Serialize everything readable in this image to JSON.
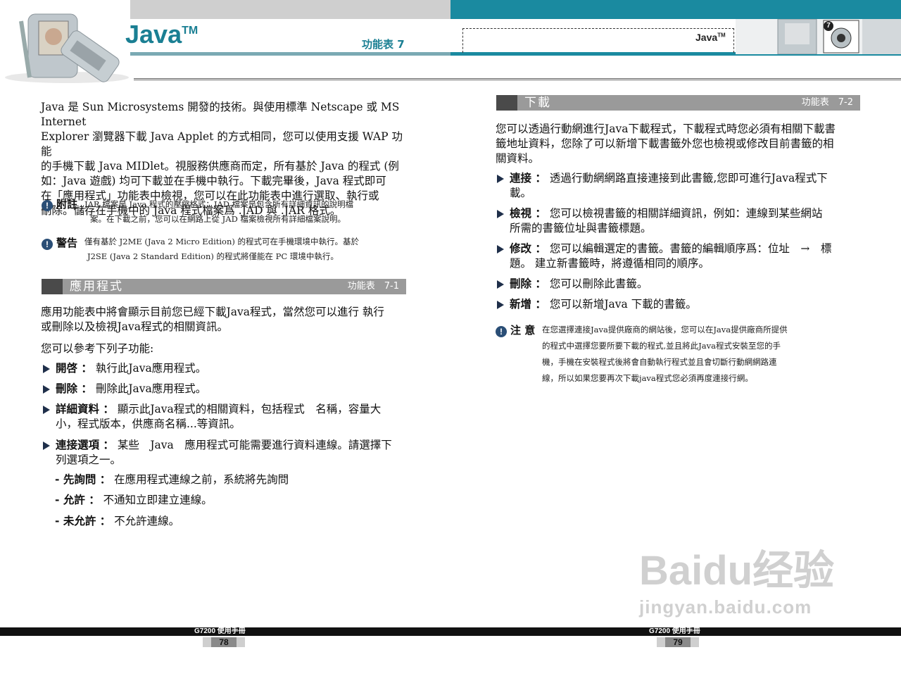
{
  "header": {
    "title": "Java",
    "title_tm": "TM",
    "left_menu": "功能表 7",
    "right_title": "Java",
    "right_tm": "TM",
    "chapter_badge": "7"
  },
  "left": {
    "intro": [
      "Java 是 Sun Microsystems 開發的技術。與使用標準 Netscape 或 MS Internet",
      "Explorer 瀏覽器下載 Java Applet 的方式相同，您可以使用支援 WAP 功能",
      "的手機下載 Java MIDlet。視服務供應商而定，所有基於 Java 的程式 (例",
      "如：Java 遊戲) 均可下載並在手機中執行。下載完畢後，Java 程式即可",
      "在「應用程式」功能表中檢視，您可以在此功能表中進行選取、執行或",
      "刪除。儲存在手機中的 Java 程式檔案爲 .JAD 與 .JAR 格式。"
    ],
    "note": {
      "label": "附註",
      "lines": [
        "JAR 檔案是 Java 程式的壓縮格式：JAD 檔案是包含所有詳細資訊的說明檔",
        "案。在下載之前，您可以在網路上從 JAD 檔案檢視所有詳細檔案說明。"
      ]
    },
    "warning": {
      "label": "警告",
      "lines": [
        "僅有基於 J2ME (Java 2 Micro Edition) 的程式可在手機環境中執行。基於",
        "J2SE (Java 2 Standard Edition) 的程式將僅能在 PC 環境中執行。"
      ]
    },
    "section": {
      "title": "應用程式",
      "ref": "功能表　7-1"
    },
    "section_intro": [
      "應用功能表中將會顯示目前您已經下載Java程式，當然您可以進行 執行",
      "或刪除以及檢視Java程式的相關資訊。"
    ],
    "sub_intro": "您可以參考下列子功能:",
    "items": [
      {
        "label": "開啓 ：",
        "text": [
          "執行此Java應用程式。"
        ]
      },
      {
        "label": "刪除 ：",
        "text": [
          "刪除此Java應用程式。"
        ]
      },
      {
        "label": "詳細資料 ：",
        "text": [
          "顯示此Java程式的相關資料，包括程式　名稱，容量大",
          "小，程式版本，供應商名稱...等資訊。"
        ]
      },
      {
        "label": "連接選項 ：",
        "text": [
          "某些　Java　應用程式可能需要進行資料連線。請選擇下",
          "列選項之一。"
        ]
      }
    ],
    "subitems": [
      {
        "label": "- 先詢問 ：",
        "text": "在應用程式連線之前，系統將先詢問"
      },
      {
        "label": "- 允許 ：",
        "text": "不通知立即建立連線。"
      },
      {
        "label": "- 未允許 ：",
        "text": "不允許連線。"
      }
    ]
  },
  "right": {
    "section": {
      "title": "下載",
      "ref": "功能表　7-2"
    },
    "intro": [
      "您可以透過行動網進行Java下載程式，下載程式時您必須有相關下載書",
      "籤地址資料，您除了可以新增下載書籤外您也檢視或修改目前書籤的相",
      "關資料。"
    ],
    "items": [
      {
        "label": "連接 ：",
        "text": [
          "透過行動網網路直接連接到此書籤,您即可進行Java程式下",
          "載。"
        ]
      },
      {
        "label": "檢視 ：",
        "text": [
          "您可以檢視書籤的相關詳細資訊，例如：連線到某些網站",
          "所需的書籤位址與書籤標題。"
        ]
      },
      {
        "label": "修改 ：",
        "text": [
          "您可以編輯選定的書籤。書籤的編輯順序爲：位址　→　標",
          "題。 建立新書籤時，將遵循相同的順序。"
        ]
      },
      {
        "label": "刪除 ：",
        "text": [
          "您可以刪除此書籤。"
        ]
      },
      {
        "label": "新增 ：",
        "text": [
          "您可以新增Java 下載的書籤。"
        ]
      }
    ],
    "note": {
      "label": "注 意",
      "lines": [
        "在您選擇連接Java提供廠商的網站後，您可以在Java提供廠商所提供",
        "的程式中選擇您要所要下載的程式,並且將此Java程式安裝至您的手",
        "機，手機在安裝程式後將會自動執行程式並且會切斷行動網網路連",
        "線，所以如果您要再次下載java程式您必須再度連接行網。"
      ]
    }
  },
  "footer": {
    "left_label": "G7200 使用手冊",
    "left_page": "78",
    "right_label": "G7200 使用手冊",
    "right_page": "79"
  },
  "watermark": {
    "logo": "Baidu经验",
    "url": "jingyan.baidu.com"
  }
}
